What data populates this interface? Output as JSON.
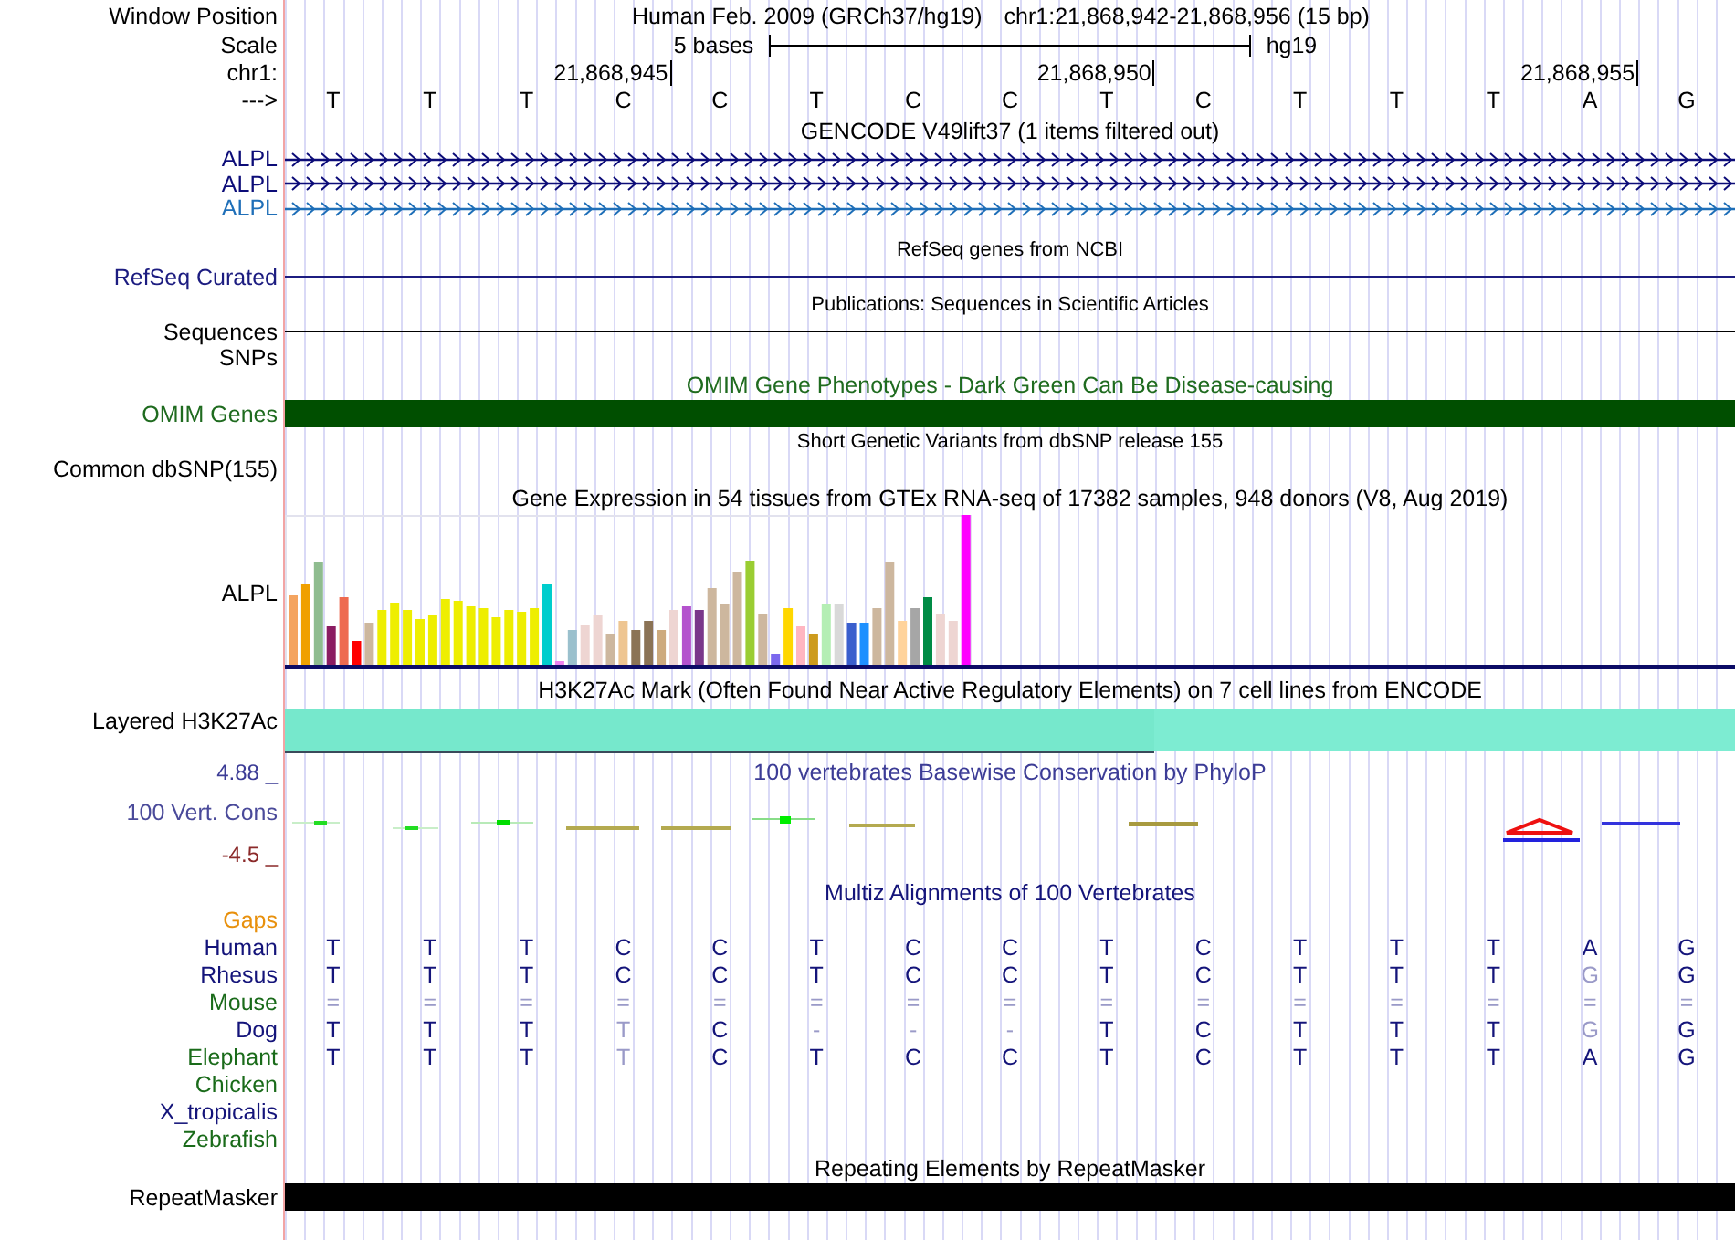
{
  "position": {
    "label": "Window Position",
    "assembly": "Human Feb. 2009 (GRCh37/hg19)",
    "range": "chr1:21,868,942-21,868,956 (15 bp)"
  },
  "scale": {
    "label": "Scale",
    "span": "5 bases",
    "db": "hg19"
  },
  "ruler": {
    "label": "chr1:",
    "ticks": [
      "21,868,945",
      "21,868,950",
      "21,868,955"
    ]
  },
  "sequence": {
    "label": "--->",
    "bases": [
      "T",
      "T",
      "T",
      "C",
      "C",
      "T",
      "C",
      "C",
      "T",
      "C",
      "T",
      "T",
      "T",
      "A",
      "G"
    ]
  },
  "tracks": [
    {
      "kind": "gencode",
      "title": "GENCODE V49lift37 (1 items filtered out)",
      "items": [
        {
          "label": "ALPL",
          "color": "#0c0c78"
        },
        {
          "label": "ALPL",
          "color": "#0c0c78"
        },
        {
          "label": "ALPL",
          "color": "#1f6fb8"
        }
      ]
    },
    {
      "kind": "line",
      "title": "RefSeq genes from NCBI",
      "labels": [
        "RefSeq Curated"
      ],
      "color": "#1c1c80"
    },
    {
      "kind": "line",
      "title": "Publications: Sequences in Scientific Articles",
      "labels": [
        "Sequences",
        "SNPs"
      ],
      "color": "#000000"
    },
    {
      "kind": "bar",
      "title": "OMIM Gene Phenotypes - Dark Green Can Be Disease-causing",
      "labels": [
        "OMIM Genes"
      ],
      "color": "#004f00"
    },
    {
      "kind": "empty",
      "title": "Short Genetic Variants from dbSNP release 155",
      "labels": [
        "Common dbSNP(155)"
      ]
    },
    {
      "kind": "expression",
      "title": "Gene Expression in 54 tissues from GTEx RNA-seq of 17382 samples, 948 donors (V8, Aug 2019)",
      "labels": [
        "ALPL"
      ]
    },
    {
      "kind": "layered",
      "title": "H3K27Ac Mark (Often Found Near Active Regulatory Elements) on 7 cell lines from ENCODE",
      "labels": [
        "Layered H3K27Ac"
      ]
    },
    {
      "kind": "phylop",
      "title": "100 vertebrates Basewise Conservation by PhyloP",
      "labels": [
        "100 Vert. Cons"
      ],
      "max": "4.88 _",
      "min": "-4.5 _"
    },
    {
      "kind": "multiz",
      "title": "Multiz Alignments of 100 Vertebrates",
      "species": [
        {
          "name": "Gaps",
          "color": "#e8900c"
        },
        {
          "name": "Human",
          "color": "#14147a",
          "bases": [
            {
              "t": "T",
              "faded": false
            },
            {
              "t": "T",
              "faded": false
            },
            {
              "t": "T",
              "faded": false
            },
            {
              "t": "C",
              "faded": false
            },
            {
              "t": "C",
              "faded": false
            },
            {
              "t": "T",
              "faded": false
            },
            {
              "t": "C",
              "faded": false
            },
            {
              "t": "C",
              "faded": false
            },
            {
              "t": "T",
              "faded": false
            },
            {
              "t": "C",
              "faded": false
            },
            {
              "t": "T",
              "faded": false
            },
            {
              "t": "T",
              "faded": false
            },
            {
              "t": "T",
              "faded": false
            },
            {
              "t": "A",
              "faded": false
            },
            {
              "t": "G",
              "faded": false
            }
          ]
        },
        {
          "name": "Rhesus",
          "color": "#14147a",
          "bases": [
            {
              "t": "T",
              "faded": false
            },
            {
              "t": "T",
              "faded": false
            },
            {
              "t": "T",
              "faded": false
            },
            {
              "t": "C",
              "faded": false
            },
            {
              "t": "C",
              "faded": false
            },
            {
              "t": "T",
              "faded": false
            },
            {
              "t": "C",
              "faded": false
            },
            {
              "t": "C",
              "faded": false
            },
            {
              "t": "T",
              "faded": false
            },
            {
              "t": "C",
              "faded": false
            },
            {
              "t": "T",
              "faded": false
            },
            {
              "t": "T",
              "faded": false
            },
            {
              "t": "T",
              "faded": false
            },
            {
              "t": "G",
              "faded": true
            },
            {
              "t": "G",
              "faded": false
            }
          ]
        },
        {
          "name": "Mouse",
          "color": "#1a6b1a",
          "bases": [
            {
              "t": "=",
              "faded": true
            },
            {
              "t": "=",
              "faded": true
            },
            {
              "t": "=",
              "faded": true
            },
            {
              "t": "=",
              "faded": true
            },
            {
              "t": "=",
              "faded": true
            },
            {
              "t": "=",
              "faded": true
            },
            {
              "t": "=",
              "faded": true
            },
            {
              "t": "=",
              "faded": true
            },
            {
              "t": "=",
              "faded": true
            },
            {
              "t": "=",
              "faded": true
            },
            {
              "t": "=",
              "faded": true
            },
            {
              "t": "=",
              "faded": true
            },
            {
              "t": "=",
              "faded": true
            },
            {
              "t": "=",
              "faded": true
            },
            {
              "t": "=",
              "faded": true
            }
          ]
        },
        {
          "name": "Dog",
          "color": "#14147a",
          "bases": [
            {
              "t": "T",
              "faded": false
            },
            {
              "t": "T",
              "faded": false
            },
            {
              "t": "T",
              "faded": false
            },
            {
              "t": "T",
              "faded": true
            },
            {
              "t": "C",
              "faded": false
            },
            {
              "t": "-",
              "faded": true
            },
            {
              "t": "-",
              "faded": true
            },
            {
              "t": "-",
              "faded": true
            },
            {
              "t": "T",
              "faded": false
            },
            {
              "t": "C",
              "faded": false
            },
            {
              "t": "T",
              "faded": false
            },
            {
              "t": "T",
              "faded": false
            },
            {
              "t": "T",
              "faded": false
            },
            {
              "t": "G",
              "faded": true
            },
            {
              "t": "G",
              "faded": false
            }
          ]
        },
        {
          "name": "Elephant",
          "color": "#1a6b1a",
          "bases": [
            {
              "t": "T",
              "faded": false
            },
            {
              "t": "T",
              "faded": false
            },
            {
              "t": "T",
              "faded": false
            },
            {
              "t": "T",
              "faded": true
            },
            {
              "t": "C",
              "faded": false
            },
            {
              "t": "T",
              "faded": false
            },
            {
              "t": "C",
              "faded": false
            },
            {
              "t": "C",
              "faded": false
            },
            {
              "t": "T",
              "faded": false
            },
            {
              "t": "C",
              "faded": false
            },
            {
              "t": "T",
              "faded": false
            },
            {
              "t": "T",
              "faded": false
            },
            {
              "t": "T",
              "faded": false
            },
            {
              "t": "A",
              "faded": false
            },
            {
              "t": "G",
              "faded": false
            }
          ]
        },
        {
          "name": "Chicken",
          "color": "#1a6b1a"
        },
        {
          "name": "X_tropicalis",
          "color": "#14147a"
        },
        {
          "name": "Zebrafish",
          "color": "#1a6b1a"
        }
      ]
    },
    {
      "kind": "bar",
      "title": "Repeating Elements by RepeatMasker",
      "labels": [
        "RepeatMasker"
      ],
      "color": "#000000"
    }
  ]
}
